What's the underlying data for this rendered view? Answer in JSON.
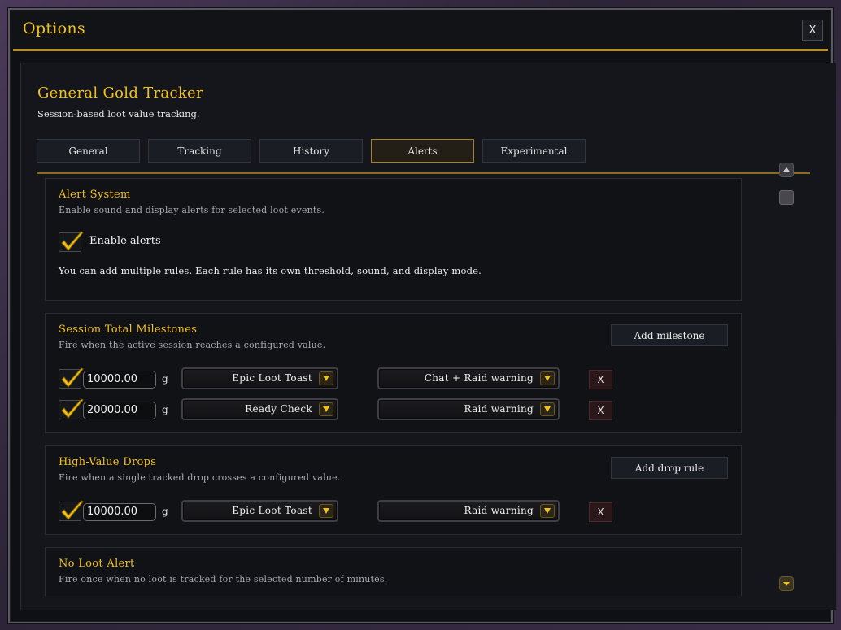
{
  "window": {
    "title": "Options",
    "close_label": "X"
  },
  "addon": {
    "title": "General Gold Tracker",
    "subtitle": "Session-based loot value tracking."
  },
  "tabs": [
    {
      "label": "General",
      "active": false
    },
    {
      "label": "Tracking",
      "active": false
    },
    {
      "label": "History",
      "active": false
    },
    {
      "label": "Alerts",
      "active": true
    },
    {
      "label": "Experimental",
      "active": false
    }
  ],
  "alert_system": {
    "title": "Alert System",
    "description": "Enable sound and display alerts for selected loot events.",
    "enable_label": "Enable alerts",
    "enabled": true,
    "note": "You can add multiple rules. Each rule has its own threshold, sound, and display mode."
  },
  "milestones": {
    "title": "Session Total Milestones",
    "description": "Fire when the active session reaches a configured value.",
    "add_label": "Add milestone",
    "rows": [
      {
        "checked": true,
        "amount": "10000.00",
        "unit": "g",
        "sound": "Epic Loot Toast",
        "display": "Chat + Raid warning",
        "delete_label": "X"
      },
      {
        "checked": true,
        "amount": "20000.00",
        "unit": "g",
        "sound": "Ready Check",
        "display": "Raid warning",
        "delete_label": "X"
      }
    ]
  },
  "drops": {
    "title": "High-Value Drops",
    "description": "Fire when a single tracked drop crosses a configured value.",
    "add_label": "Add drop rule",
    "rows": [
      {
        "checked": true,
        "amount": "10000.00",
        "unit": "g",
        "sound": "Epic Loot Toast",
        "display": "Raid warning",
        "delete_label": "X"
      }
    ]
  },
  "no_loot": {
    "title": "No Loot Alert",
    "description": "Fire once when no loot is tracked for the selected number of minutes."
  },
  "colors": {
    "accent_gold": "#f2c11c",
    "panel_bg": "#15161c",
    "delete_red": "#2a1719"
  }
}
